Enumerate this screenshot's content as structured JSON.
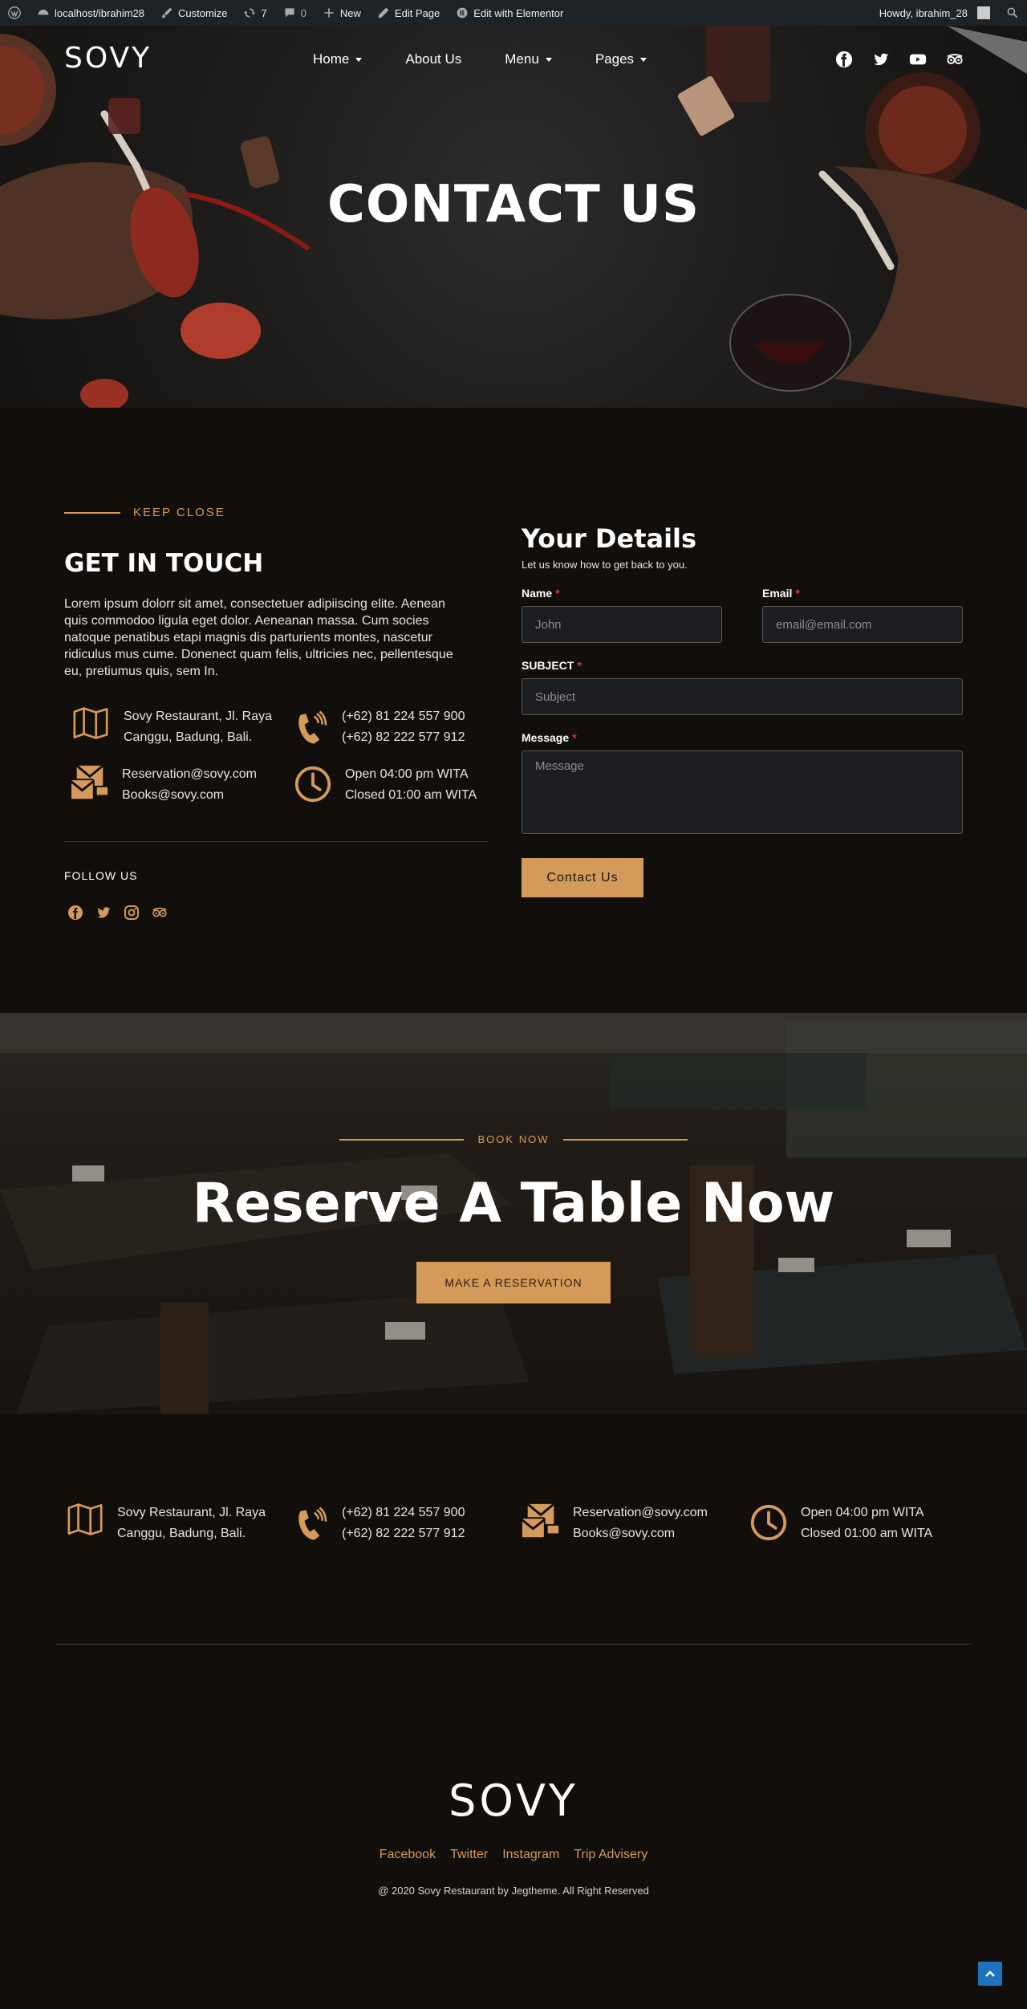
{
  "admin_bar": {
    "site": "localhost/ibrahim28",
    "customize": "Customize",
    "updates": "7",
    "comments": "0",
    "new": "New",
    "edit_page": "Edit Page",
    "edit_elementor": "Edit with Elementor",
    "howdy": "Howdy, ibrahim_28"
  },
  "header": {
    "logo": "SOVY",
    "menu": [
      "Home",
      "About Us",
      "Menu",
      "Pages"
    ],
    "social_icons": [
      "facebook-icon",
      "twitter-icon",
      "youtube-icon",
      "tripadvisor-icon"
    ]
  },
  "hero": {
    "title": "CONTACT US"
  },
  "contact": {
    "kicker": "KEEP CLOSE",
    "title": "GET IN TOUCH",
    "text": "Lorem ipsum dolorr sit amet, consectetuer adipiiscing elite. Aenean quis commodoo ligula eget dolor. Aeneanan massa. Cum socies natoque penatibus etapi magnis dis parturients montes, nascetur ridiculus mus cume. Donenect quam felis, ultricies nec, pellentesque eu, pretiumus quis, sem In.",
    "address": [
      "Sovy Restaurant, Jl. Raya",
      "Canggu, Badung, Bali."
    ],
    "phone": [
      "(+62) 81 224 557 900",
      "(+62) 82 222 577 912"
    ],
    "email": [
      "Reservation@sovy.com",
      "Books@sovy.com"
    ],
    "hours": [
      "Open 04:00 pm WITA",
      "Closed 01:00 am WITA"
    ],
    "follow": "FOLLOW US"
  },
  "form": {
    "title": "Your Details",
    "subtitle": "Let us know how to get back to you.",
    "name_label": "Name",
    "name_placeholder": "John",
    "email_label": "Email",
    "email_placeholder": "email@email.com",
    "subject_label": "SUBJECT",
    "subject_placeholder": "Subject",
    "message_label": "Message",
    "message_placeholder": "Message",
    "submit": "Contact Us"
  },
  "reserve": {
    "kicker": "BOOK NOW",
    "title": "Reserve A Table Now",
    "button": "MAKE A RESERVATION"
  },
  "footer": {
    "logo": "SOVY",
    "links": [
      "Facebook",
      "Twitter",
      "Instagram",
      "Trip Advisery"
    ],
    "copyright": "@ 2020 Sovy Restaurant by Jegtheme. All Right Reserved"
  },
  "colors": {
    "accent": "#d49a5a",
    "background": "#120e0c",
    "admin_bar": "#1d2327"
  }
}
